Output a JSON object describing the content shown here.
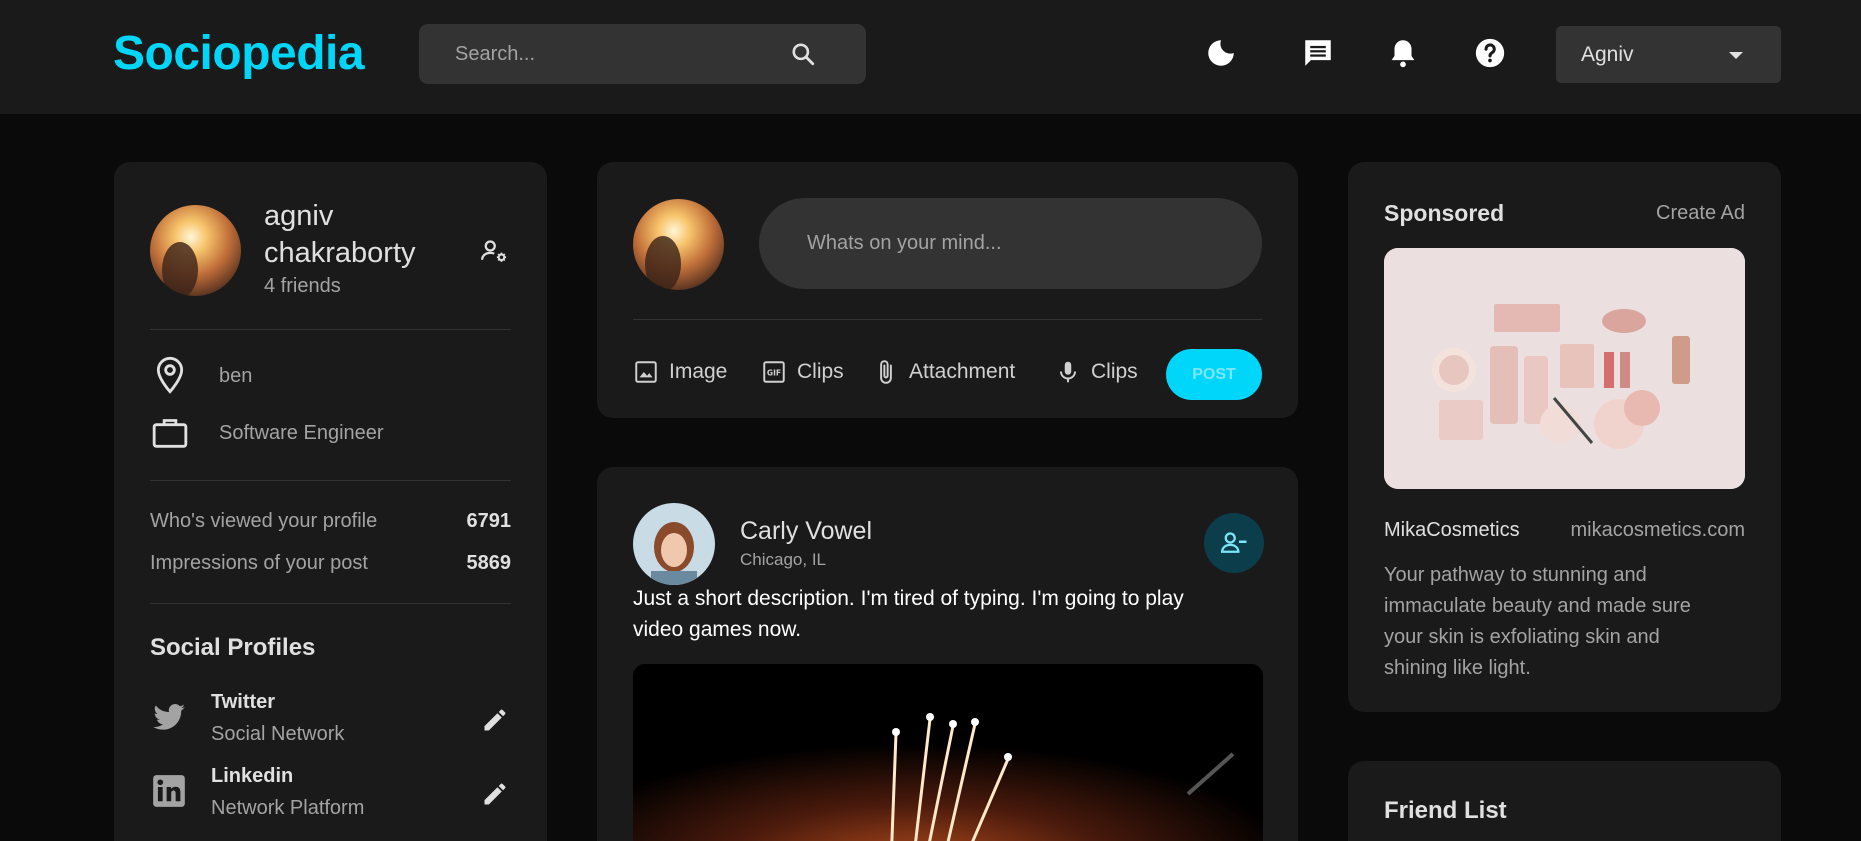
{
  "navbar": {
    "logo": "Sociopedia",
    "search_placeholder": "Search...",
    "user_name": "Agniv",
    "icons": [
      "moon-icon",
      "message-icon",
      "bell-icon",
      "help-icon"
    ]
  },
  "profile": {
    "name": "agniv chakraborty",
    "friends": "4 friends",
    "location": "ben",
    "occupation": "Software Engineer",
    "stats": [
      {
        "label": "Who's viewed your profile",
        "value": "6791"
      },
      {
        "label": "Impressions of your post",
        "value": "5869"
      }
    ],
    "social_title": "Social Profiles",
    "socials": [
      {
        "name": "Twitter",
        "sub": "Social Network"
      },
      {
        "name": "Linkedin",
        "sub": "Network Platform"
      }
    ]
  },
  "composer": {
    "placeholder": "Whats on your mind...",
    "tools": [
      {
        "label": "Image",
        "icon": "image-icon"
      },
      {
        "label": "Clips",
        "icon": "gif-icon"
      },
      {
        "label": "Attachment",
        "icon": "attachment-icon"
      },
      {
        "label": "Clips",
        "icon": "microphone-icon"
      }
    ],
    "post_label": "POST"
  },
  "post": {
    "name": "Carly Vowel",
    "location": "Chicago, IL",
    "description": "Just a short description. I'm tired of typing. I'm going to play video games now."
  },
  "sponsored": {
    "title": "Sponsored",
    "create_ad": "Create Ad",
    "brand": "MikaCosmetics",
    "site": "mikacosmetics.com",
    "description": "Your pathway to stunning and immaculate beauty and made sure your skin is exfoliating skin and shining like light."
  },
  "friend_list": {
    "title": "Friend List"
  },
  "colors": {
    "accent": "#00d5fa",
    "background": "#0a0a0a",
    "card": "#1a1a1a",
    "input": "#333333"
  }
}
